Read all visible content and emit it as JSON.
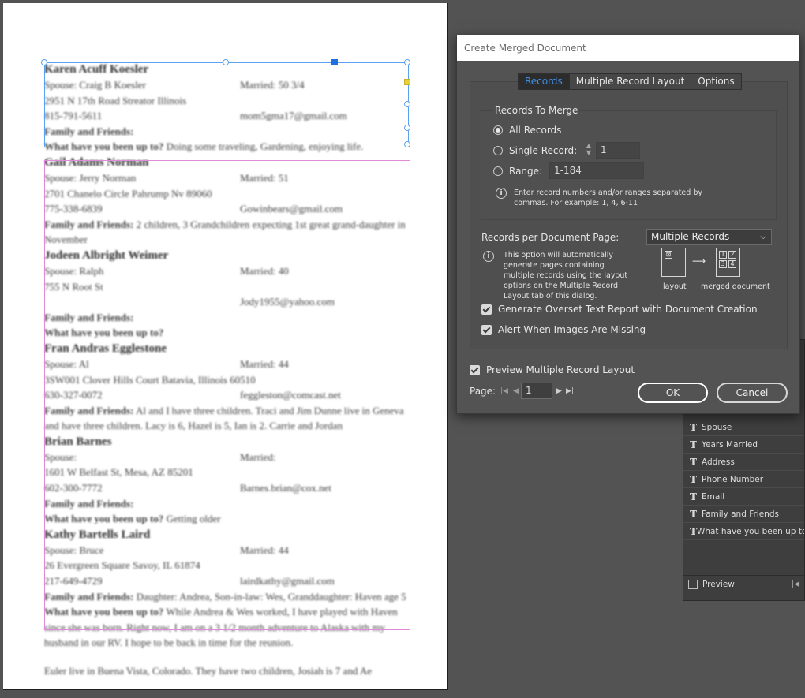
{
  "dialog": {
    "title": "Create Merged Document",
    "tabs": [
      "Records",
      "Multiple Record Layout",
      "Options"
    ],
    "active_tab": "Records",
    "records_to_merge": {
      "title": "Records To Merge",
      "all_records_label": "All Records",
      "single_record_label": "Single Record:",
      "single_record_value": "1",
      "range_label": "Range:",
      "range_value": "1-184",
      "selected": "All Records",
      "hint": "Enter record numbers and/or ranges separated by commas. For example: 1, 4, 6-11"
    },
    "records_per_page": {
      "label": "Records per Document Page:",
      "value": "Multiple Records",
      "hint": "This option will automatically generate pages containing multiple records using the layout options on the Multiple Record Layout tab of this dialog.",
      "layout_caption": "layout",
      "merged_caption": "merged document",
      "cells": [
        "1",
        "2",
        "3",
        "4"
      ]
    },
    "overset_label": "Generate Overset Text Report with Document Creation",
    "overset_checked": true,
    "alert_label": "Alert When Images Are Missing",
    "alert_checked": true,
    "preview_label": "Preview Multiple Record Layout",
    "preview_checked": true,
    "page_label": "Page:",
    "page_value": "1",
    "ok_label": "OK",
    "cancel_label": "Cancel"
  },
  "data_merge_panel": {
    "fields": [
      "Spouse",
      "Years Married",
      "Address",
      "Phone Number",
      "Email",
      "Family and Friends",
      "What have you been up to"
    ],
    "field_icon": "T",
    "preview_label": "Preview",
    "preview_checked": false
  },
  "document": {
    "records": [
      {
        "name": "Karen Acuff Koesler",
        "spouse": "Spouse: Craig B Koesler",
        "married": "Married: 50 3/4",
        "address": "2951 N 17th Road Streator Illinois",
        "phone": "815-791-5611",
        "email": "mom5gma17@gmail.com",
        "family": "Family and Friends:",
        "upto_label": "What have you been up to?",
        "upto_text": " Doing some traveling, Gardening, enjoying life."
      },
      {
        "name": "Gail Adams Norman",
        "spouse": "Spouse: Jerry Norman",
        "married": "Married: 51",
        "address": "2701 Chanelo Circle Pahrump Nv 89060",
        "phone": "775-338-6839",
        "email": "Gowinbears@gmail.com",
        "family": "Family and Friends:",
        "family_text": " 2 children, 3 Grandchildren expecting 1st great grand-daughter in November"
      },
      {
        "name": "Jodeen Albright Weimer",
        "spouse": "Spouse: Ralph",
        "married": "Married: 40",
        "address": "755 N Root St",
        "email": "Jody1955@yahoo.com",
        "family": "Family and Friends:",
        "upto_label": "What have you been up to?"
      },
      {
        "name": "Fran Andras Egglestone",
        "spouse": "Spouse: Al",
        "married": "Married: 44",
        "address": "3SW001 Clover Hills Court Batavia, Illinois 60510",
        "phone": "630-327-0072",
        "email": "feggleston@comcast.net",
        "family": "Family and Friends:",
        "family_text": " Al and I have three children. Traci and Jim Dunne live in Geneva and have three children. Lacy is 6, Hazel is 5, Ian is 2. Carrie and Jordan"
      },
      {
        "name": "Brian Barnes",
        "spouse": "Spouse:",
        "married": "Married:",
        "address": "1601 W Belfast St, Mesa, AZ 85201",
        "phone": "602-300-7772",
        "email": "Barnes.brian@cox.net",
        "family": "Family and Friends:",
        "upto_label": "What have you been up to?",
        "upto_text": " Getting older"
      },
      {
        "name": "Kathy Bartells Laird",
        "spouse": "Spouse: Bruce",
        "married": "Married: 44",
        "address": "26 Evergreen Square Savoy, IL 61874",
        "phone": "217-649-4729",
        "email": "lairdkathy@gmail.com",
        "family": "Family and Friends:",
        "family_text": " Daughter: Andrea, Son-in-law: Wes, Granddaughter: Haven age 5",
        "upto_label": "What have you been up to?",
        "upto_text": " While Andrea & Wes worked, I have played with Haven since she was born. Right now, I am on a 3 1/2 month adventure to Alaska with my husband in our RV. I hope to be back in time for the reunion."
      }
    ],
    "trailing_text": "Euler live in Buena Vista, Colorado. They have two children, Josiah is 7 and Ae"
  }
}
